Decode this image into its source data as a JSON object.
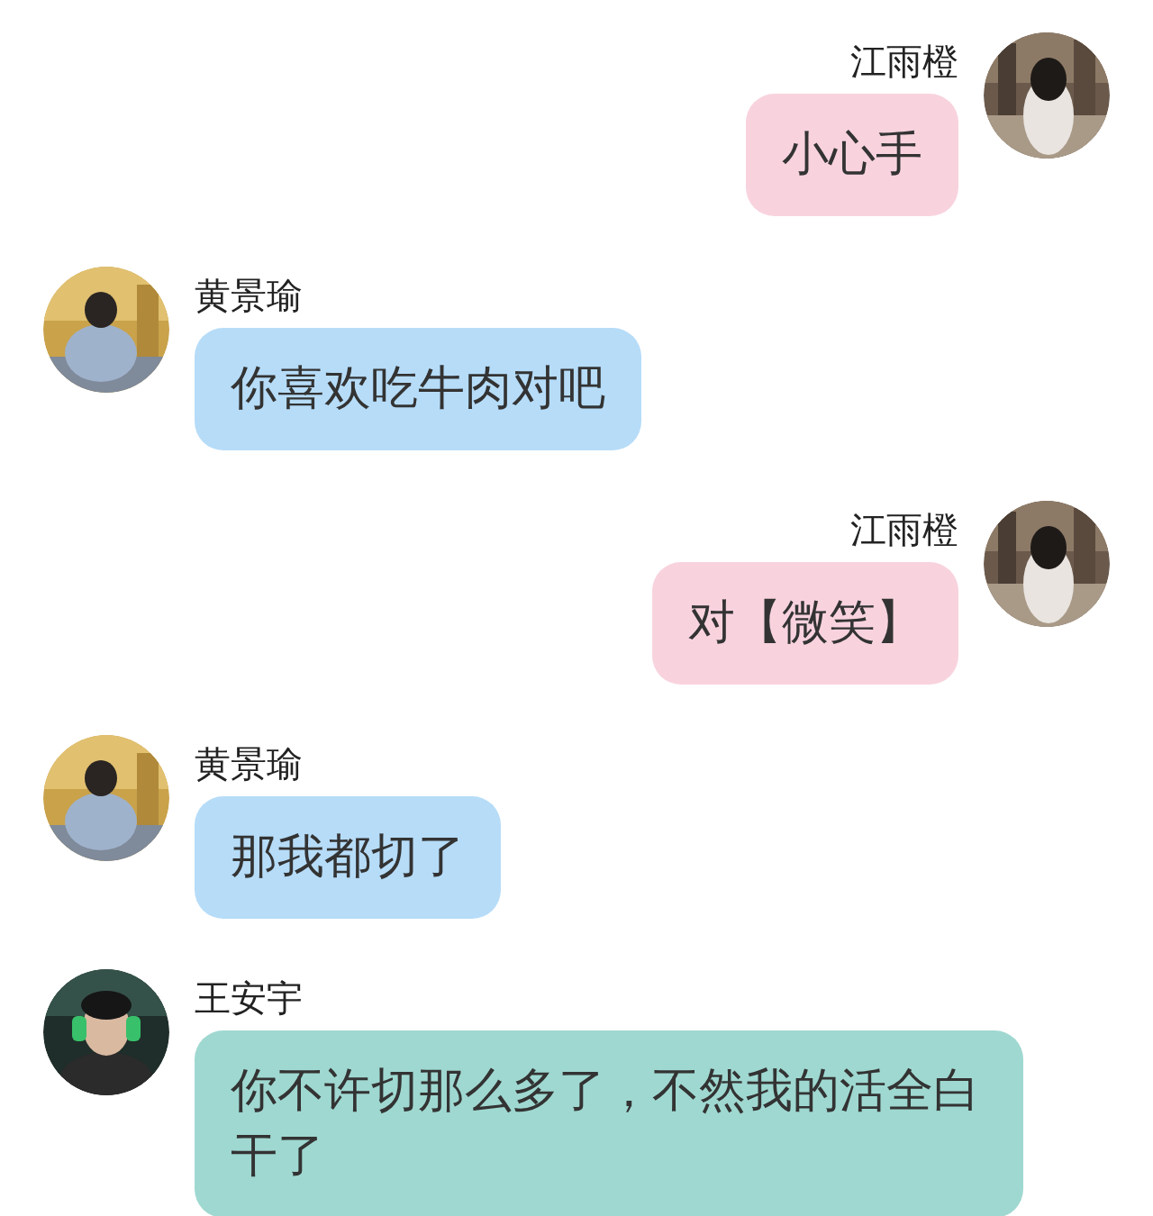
{
  "messages": [
    {
      "kind": "outgoing",
      "sender": "江雨橙",
      "text": "小心手",
      "color": "#f8d3de"
    },
    {
      "kind": "incoming",
      "sender": "黄景瑜",
      "text": "你喜欢吃牛肉对吧",
      "color": "#b6dcf8"
    },
    {
      "kind": "outgoing",
      "sender": "江雨橙",
      "text": "对【微笑】",
      "color": "#f8d3de"
    },
    {
      "kind": "incoming",
      "sender": "黄景瑜",
      "text": "那我都切了",
      "color": "#b6dcf8"
    },
    {
      "kind": "incoming",
      "sender": "王安宇",
      "text": "你不许切那么多了，不然我的活全白干了",
      "color": "#9fd8d1"
    }
  ]
}
